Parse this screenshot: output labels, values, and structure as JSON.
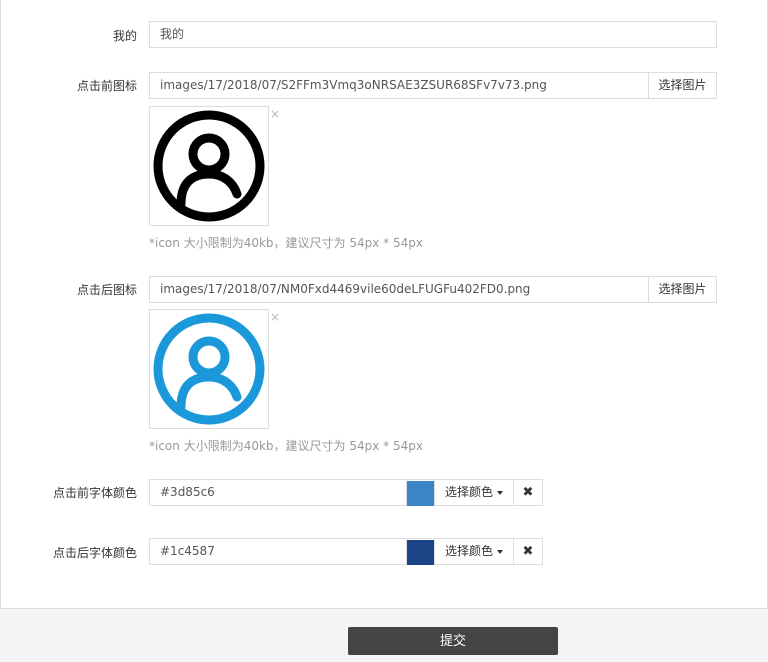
{
  "form": {
    "mine": {
      "label": "我的",
      "value": "我的"
    },
    "before_icon": {
      "label": "点击前图标",
      "value": "images/17/2018/07/S2FFm3Vmq3oNRSAE3ZSUR68SFv7v73.png",
      "button": "选择图片",
      "remove": "×",
      "hint": "*icon 大小限制为40kb，建议尺寸为 54px * 54px",
      "icon_color": "#000000",
      "icon": "user-circle-icon"
    },
    "after_icon": {
      "label": "点击后图标",
      "value": "images/17/2018/07/NM0Fxd4469vile60deLFUGFu402FD0.png",
      "button": "选择图片",
      "remove": "×",
      "hint": "*icon 大小限制为40kb，建议尺寸为 54px * 54px",
      "icon_color": "#1a98d9",
      "icon": "user-circle-icon"
    },
    "before_color": {
      "label": "点击前字体颜色",
      "value": "#3d85c6",
      "button": "选择颜色",
      "clear": "✖"
    },
    "after_color": {
      "label": "点击后字体颜色",
      "value": "#1c4587",
      "button": "选择颜色",
      "clear": "✖"
    }
  },
  "submit": {
    "label": "提交"
  }
}
